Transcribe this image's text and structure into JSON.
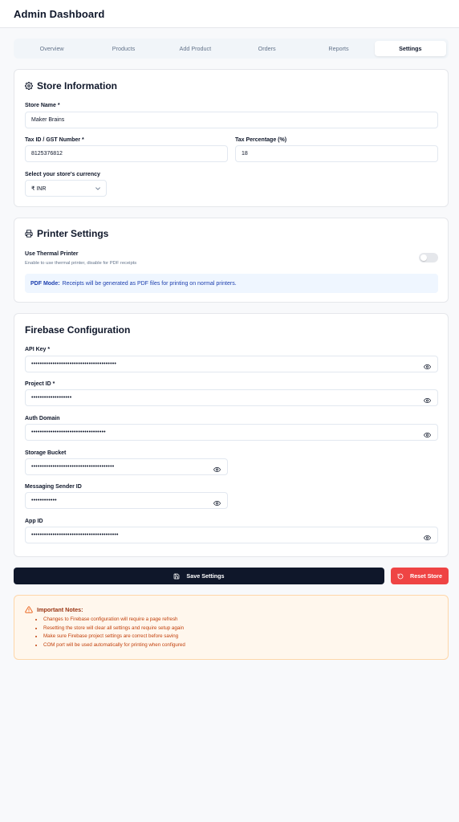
{
  "header": {
    "title": "Admin Dashboard"
  },
  "tabs": [
    {
      "label": "Overview"
    },
    {
      "label": "Products"
    },
    {
      "label": "Add Product"
    },
    {
      "label": "Orders"
    },
    {
      "label": "Reports"
    },
    {
      "label": "Settings",
      "active": true
    }
  ],
  "store": {
    "title": "Store Information",
    "icon": "gear-icon",
    "name_label": "Store Name *",
    "name_value": "Maker Brains",
    "tax_id_label": "Tax ID / GST Number *",
    "tax_id_value": "8125376812",
    "tax_pct_label": "Tax Percentage (%)",
    "tax_pct_value": "18",
    "currency_label": "Select your store's currency",
    "currency_value": "₹ INR"
  },
  "printer": {
    "title": "Printer Settings",
    "icon": "printer-icon",
    "thermal_label": "Use Thermal Printer",
    "thermal_hint": "Enable to use thermal printer, disable for PDF receipts",
    "thermal_enabled": false,
    "info_bold": "PDF Mode:",
    "info_text": "Receipts will be generated as PDF files for printing on normal printers."
  },
  "firebase": {
    "title": "Firebase Configuration",
    "fields": [
      {
        "label": "API Key *",
        "value": "••••••••••••••••••••••••••••••••••••••••"
      },
      {
        "label": "Project ID *",
        "value": "•••••••••••••••••••"
      },
      {
        "label": "Auth Domain",
        "value": "•••••••••••••••••••••••••••••••••••"
      },
      {
        "label": "Storage Bucket",
        "value": "•••••••••••••••••••••••••••••••••••••••"
      },
      {
        "label": "Messaging Sender ID",
        "value": "••••••••••••"
      },
      {
        "label": "App ID",
        "value": "•••••••••••••••••••••••••••••••••••••••••"
      }
    ]
  },
  "actions": {
    "save_label": "Save Settings",
    "reset_label": "Reset Store"
  },
  "notes": {
    "title": "Important Notes:",
    "items": [
      "Changes to Firebase configuration will require a page refresh",
      "Resetting the store will clear all settings and require setup again",
      "Make sure Firebase project settings are correct before saving",
      "COM port will be used automatically for printing when configured"
    ]
  },
  "colors": {
    "primary": "#0f172a",
    "danger": "#ef4444",
    "info_bg": "#eff6ff",
    "warning_bg": "#fff7ed"
  }
}
